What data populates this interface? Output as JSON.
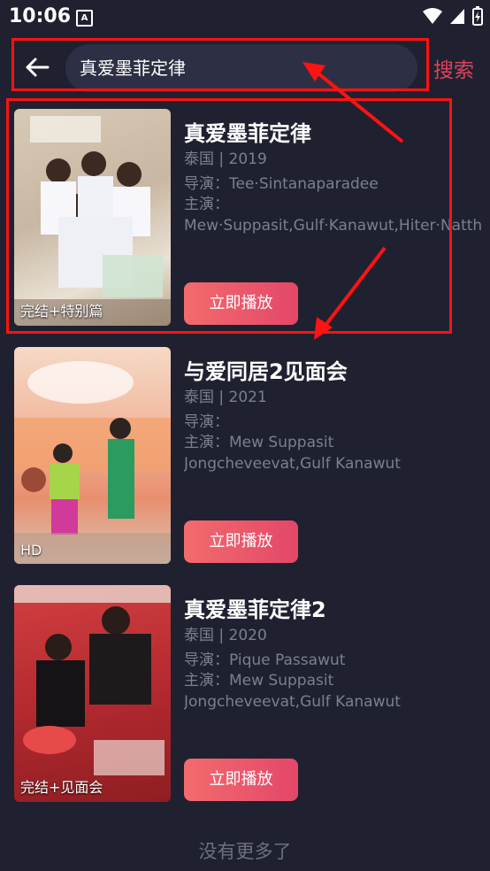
{
  "status_bar": {
    "time": "10:06",
    "notif_glyph": "A"
  },
  "search": {
    "query": "真爱墨菲定律",
    "search_label": "搜索"
  },
  "results": [
    {
      "title": "真爱墨菲定律",
      "region_year": "泰国 | 2019",
      "director": "导演：Tee·Sintanaparadee",
      "cast": "主演：Mew·Suppasit,Gulf·Kanawut,Hiter·Natthad,Kokliang·Parinya·Angsanan,Mild·",
      "badge": "完结+特别篇",
      "play_label": "立即播放"
    },
    {
      "title": "与爱同居2见面会",
      "region_year": "泰国 | 2021",
      "director": "导演：",
      "cast": "主演：Mew Suppasit Jongcheveevat,Gulf Kanawut Traipipattanapong,First",
      "badge": "HD",
      "play_label": "立即播放"
    },
    {
      "title": "真爱墨菲定律2",
      "region_year": "泰国 | 2020",
      "director": "导演：Pique Passawut",
      "cast": "主演：Mew Suppasit Jongcheveevat,Gulf Kanawut Traipipattanapong,First",
      "badge": "完结+见面会",
      "play_label": "立即播放"
    }
  ],
  "footer": {
    "text": "没有更多了"
  },
  "colors": {
    "accent": "#e0415b",
    "background": "#1f2130",
    "annotation": "#ff1212"
  }
}
